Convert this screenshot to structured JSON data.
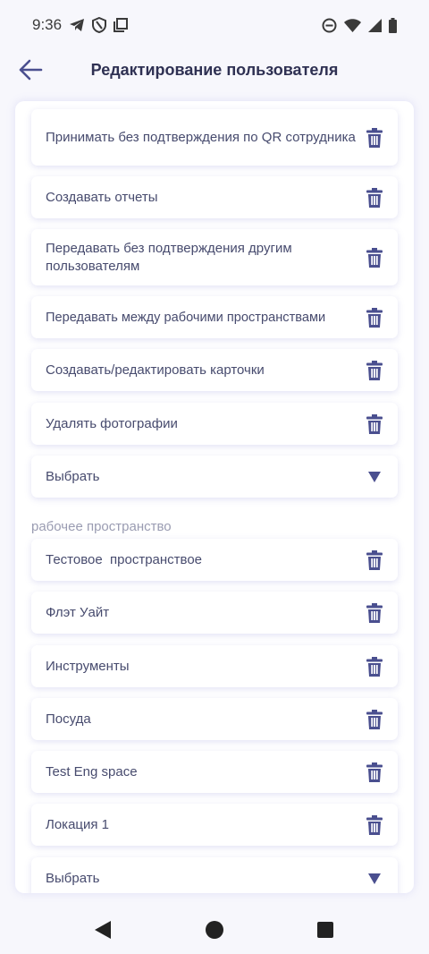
{
  "status_bar": {
    "time": "9:36",
    "icons": [
      "telegram-icon",
      "shield-icon",
      "window-icon",
      "dnd-icon",
      "wifi-icon",
      "signal-icon",
      "battery-icon"
    ]
  },
  "header": {
    "title": "Редактирование пользователя",
    "back_icon": "arrow-left-icon"
  },
  "permissions": [
    {
      "label": "Принимать без подтверждения по QR сотрудника"
    },
    {
      "label": "Создавать отчеты"
    },
    {
      "label": "Передавать без подтверждения другим пользователям"
    },
    {
      "label": "Передавать между рабочими пространствами"
    },
    {
      "label": "Создавать/редактировать карточки"
    },
    {
      "label": "Удалять фотографии"
    }
  ],
  "permissions_select": {
    "label": "Выбрать"
  },
  "workspace_section": {
    "label": "рабочее пространство"
  },
  "workspaces": [
    {
      "label": "Тестовое  пространствое"
    },
    {
      "label": "Флэт Уайт"
    },
    {
      "label": "Инструменты"
    },
    {
      "label": "Посуда"
    },
    {
      "label": "Test Eng space"
    },
    {
      "label": "Локация 1"
    }
  ],
  "workspaces_select": {
    "label": "Выбрать"
  },
  "colors": {
    "accent": "#4a4f8f",
    "text": "#474b6e",
    "muted": "#9a9cb2",
    "background": "#f7f7fc"
  }
}
